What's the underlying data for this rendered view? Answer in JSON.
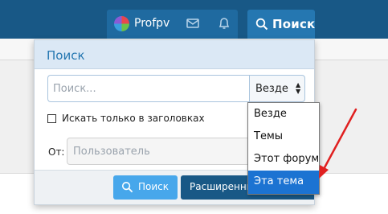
{
  "navbar": {
    "username": "Profpv",
    "icons": [
      "avatar",
      "mail-icon",
      "bell-icon",
      "search-icon"
    ],
    "search_tab_label": "Поиск"
  },
  "search_popup": {
    "title": "Поиск",
    "search_placeholder": "Поиск...",
    "scope_selected": "Везде",
    "titles_only_label": "Искать только в заголовках",
    "titles_only_checked": false,
    "member_label": "От:",
    "member_placeholder": "Пользователь",
    "search_button_label": "Поиск",
    "advanced_button_label": "Расширенный поиск"
  },
  "scope_dropdown": {
    "options": [
      "Везде",
      "Темы",
      "Этот форум",
      "Эта тема"
    ],
    "highlighted": "Эта тема"
  },
  "colors": {
    "navbar": "#185886",
    "accent": "#2577b1",
    "button": "#47a7eb",
    "highlight": "#1c73d2",
    "annotation_arrow": "#e02020"
  }
}
